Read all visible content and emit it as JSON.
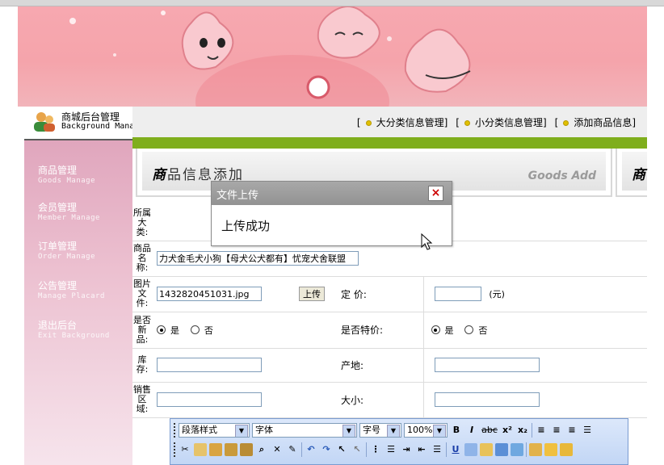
{
  "logo": {
    "title_cn": "商城后台管理",
    "title_en": "Background Manage"
  },
  "topnav": {
    "links": [
      "[",
      "大分类信息管理]",
      "[",
      "小分类信息管理]",
      "[",
      "添加商品信息]"
    ]
  },
  "sidebar": {
    "items": [
      {
        "cn": "商品管理",
        "en": "Goods Manage"
      },
      {
        "cn": "会员管理",
        "en": "Member Manage"
      },
      {
        "cn": "订单管理",
        "en": "Order Manage"
      },
      {
        "cn": "公告管理",
        "en": "Manage Placard"
      },
      {
        "cn": "退出后台",
        "en": "Exit Background"
      }
    ]
  },
  "panel": {
    "title_bold": "商",
    "title_rest": "品信息添加",
    "title_en": "Goods Add",
    "second_title": "商"
  },
  "form": {
    "category_label": "所属大类:",
    "name_label": "商品名称:",
    "name_value": "力犬金毛犬小狗【母犬公犬都有】忧宠犬舍联盟",
    "image_label": "图片文件:",
    "image_value": "1432820451031.jpg",
    "upload_button": "上传",
    "price_label": "定 价:",
    "price_unit": "(元)",
    "new_label": "是否新品:",
    "special_label": "是否特价:",
    "yes": "是",
    "no": "否",
    "stock_label": "库存:",
    "origin_label": "产地:",
    "region_label": "销售区域:",
    "size_label": "大小:"
  },
  "editor": {
    "paragraph": "段落样式",
    "font": "字体",
    "fontsize": "字号",
    "zoom": "100%",
    "bold": "B",
    "italic": "I",
    "underline": "U",
    "strike": "abc",
    "sup": "x²",
    "sub": "x₂"
  },
  "dialog": {
    "title": "文件上传",
    "close": "×",
    "message": "上传成功"
  }
}
